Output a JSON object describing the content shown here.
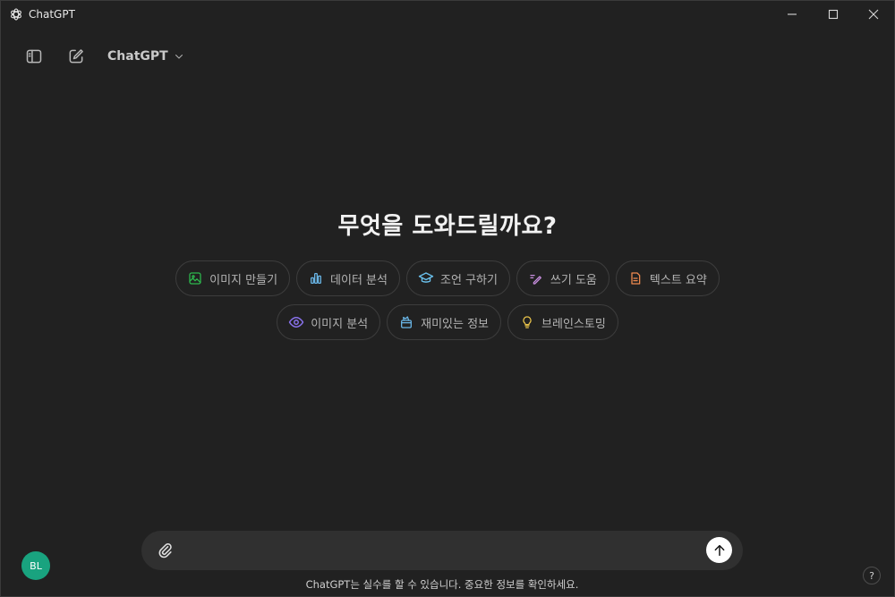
{
  "window": {
    "title": "ChatGPT",
    "controls": {
      "minimize": "minimize-icon",
      "maximize": "maximize-icon",
      "close": "close-icon"
    }
  },
  "header": {
    "sidebar_toggle_icon": "sidebar-icon",
    "new_chat_icon": "edit-icon",
    "model_label": "ChatGPT",
    "model_chevron": "chevron-down-icon"
  },
  "main": {
    "headline": "무엇을 도와드릴까요?",
    "suggestions_row1": [
      {
        "label": "이미지 만들기",
        "icon": "image-icon",
        "color": "#2db84d"
      },
      {
        "label": "데이터 분석",
        "icon": "bar-chart-icon",
        "color": "#6ab7e8"
      },
      {
        "label": "조언 구하기",
        "icon": "graduation-cap-icon",
        "color": "#6ac0ec"
      },
      {
        "label": "쓰기 도움",
        "icon": "pen-icon",
        "color": "#c98fe0"
      },
      {
        "label": "텍스트 요약",
        "icon": "document-icon",
        "color": "#ef8a4f"
      }
    ],
    "suggestions_row2": [
      {
        "label": "이미지 분석",
        "icon": "eye-icon",
        "color": "#8a73ef"
      },
      {
        "label": "재미있는 정보",
        "icon": "gift-icon",
        "color": "#6ab7e8"
      },
      {
        "label": "브레인스토밍",
        "icon": "lightbulb-icon",
        "color": "#e8c24a"
      }
    ]
  },
  "composer": {
    "placeholder": "",
    "attach_icon": "paperclip-icon",
    "send_icon": "arrow-up-icon"
  },
  "footer": {
    "disclaimer": "ChatGPT는 실수를 할 수 있습니다. 중요한 정보를 확인하세요.",
    "avatar_initials": "BL",
    "help_label": "?"
  },
  "colors": {
    "background": "#212121",
    "composer": "#303030",
    "avatar": "#19a37f"
  }
}
